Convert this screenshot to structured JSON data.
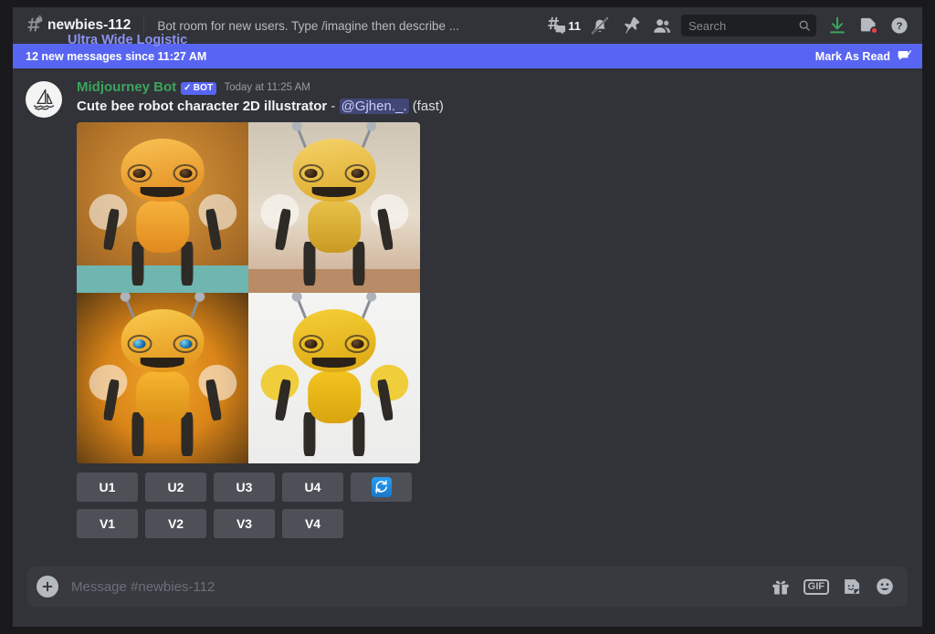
{
  "header": {
    "channel_icon": "hash-lock-icon",
    "channel_name": "newbies-112",
    "topic": "Bot room for new users. Type /imagine then describe ...",
    "threads_icon": "threads-icon",
    "thread_count": "11",
    "notifications_icon": "bell-muted-icon",
    "pin_icon": "pin-icon",
    "members_icon": "members-icon",
    "search_placeholder": "Search",
    "search_icon": "search-icon",
    "inbox_icon": "inbox-icon",
    "downloads_icon": "download-icon",
    "help_icon": "help-icon",
    "download_color": "#3ba55c",
    "badge_color": "#f23f43"
  },
  "new_messages_banner": {
    "text": "12 new messages since 11:27 AM",
    "mark_as_read": "Mark As Read",
    "mark_icon": "mark-read-icon",
    "background": "#5865f2",
    "obscured_text": "Ultra Wide Logistic"
  },
  "message": {
    "avatar_icon": "midjourney-sailboat-avatar",
    "author": "Midjourney Bot",
    "author_color": "#3ba55c",
    "bot_badge": "BOT",
    "bot_badge_check": "✓",
    "bot_badge_color": "#5865f2",
    "timestamp": "Today at 11:25 AM",
    "prompt": "Cute bee robot character 2D illustrator",
    "separator": "-",
    "mention": "@Gjhen._.",
    "speed": "(fast)"
  },
  "image_grid": {
    "alt": "Four generated bee robot character images",
    "cells": [
      {
        "name": "upscale-preview-1",
        "background": "radial-gradient(circle at 50% 40%, #d79a3c 0%, #b5762a 55%, #8c5a22 100%)",
        "floor": "#6fb5b0",
        "body": "linear-gradient(180deg,#f7b23c,#e08a1e)",
        "head": "linear-gradient(170deg,#f9c254,#e2891c)",
        "eyes": "brown",
        "wings": true,
        "antenna": false
      },
      {
        "name": "upscale-preview-2",
        "background": "linear-gradient(180deg,#cfc5b4 0%, #e6dccb 55%, #c9a88c 100%)",
        "floor": "#b98b66",
        "body": "linear-gradient(180deg,#e8c24a,#c99a22)",
        "head": "linear-gradient(170deg,#f4d369,#dca828)",
        "eyes": "brown",
        "wings": true,
        "antenna": true
      },
      {
        "name": "upscale-preview-3",
        "background": "radial-gradient(circle at 50% 45%, #f0a32a 0%, #d98418 50%, #5c3a12 100%)",
        "floor": "#e09420",
        "body": "linear-gradient(180deg,#f6b52f,#d98d15)",
        "head": "linear-gradient(170deg,#facc4e,#e09018)",
        "eyes": "blue",
        "wings": true,
        "antenna": true
      },
      {
        "name": "upscale-preview-4",
        "background": "linear-gradient(180deg,#f4f4f2 0%, #ececeb 100%)",
        "floor": "#ededeb",
        "body": "linear-gradient(180deg,#f2c41f,#d9a40f)",
        "head": "linear-gradient(170deg,#f6cf35,#dba714)",
        "eyes": "brown",
        "wings": true,
        "antenna": true
      }
    ]
  },
  "actions": {
    "upscale_row": [
      "U1",
      "U2",
      "U3",
      "U4"
    ],
    "variation_row": [
      "V1",
      "V2",
      "V3",
      "V4"
    ],
    "reroll_icon": "reroll-icon",
    "reroll_color": "#2a9df4"
  },
  "composer": {
    "add_icon": "plus-icon",
    "placeholder": "Message #newbies-112",
    "gift_icon": "gift-icon",
    "gif_label": "GIF",
    "sticker_icon": "sticker-icon",
    "emoji_icon": "emoji-icon"
  }
}
